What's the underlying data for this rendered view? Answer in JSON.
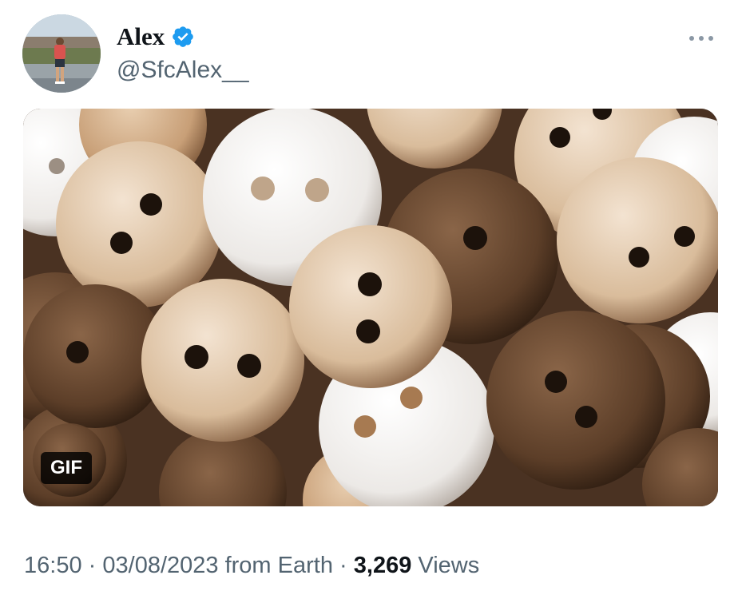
{
  "tweet": {
    "author": {
      "display_name": "Alex",
      "handle": "@SfcAlex__",
      "verified_icon": "verified-badge-icon",
      "verified_color": "#1d9bf0"
    },
    "more_icon": "more-options-icon",
    "media": {
      "badge": "GIF",
      "subject": "coconut-buttons"
    },
    "meta": {
      "time": "16:50",
      "separator": "·",
      "date": "03/08/2023",
      "source": "from Earth",
      "separator2": "·",
      "views_count": "3,269",
      "views_label": "Views"
    }
  }
}
